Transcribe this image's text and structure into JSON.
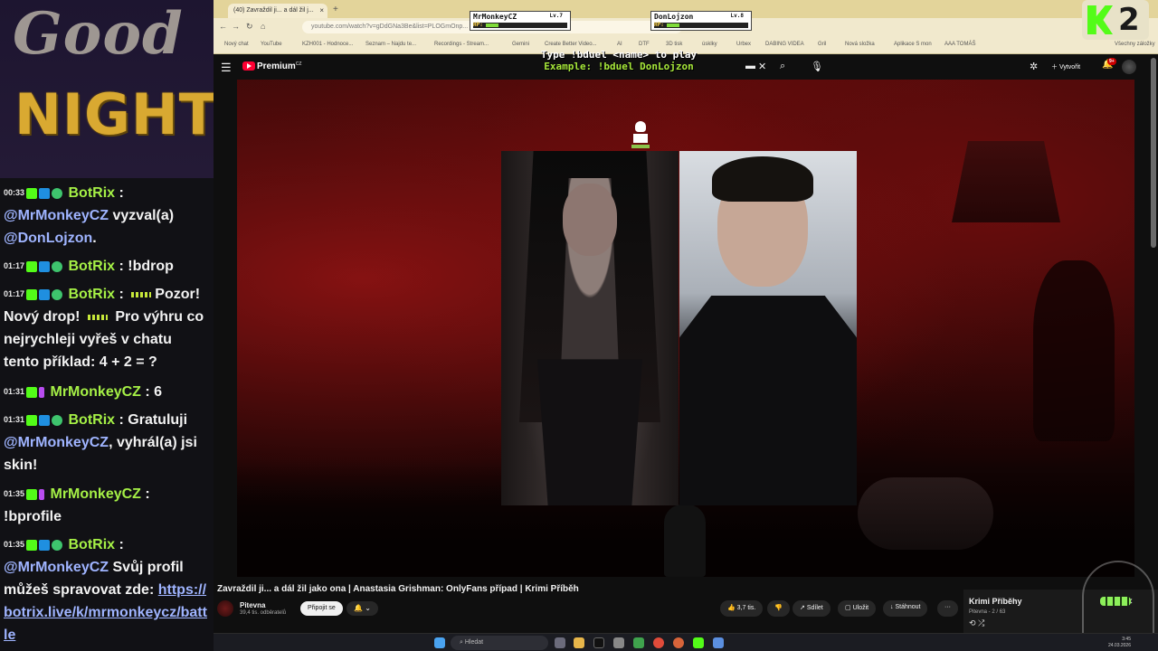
{
  "overlay": {
    "good": "Good",
    "night": "NIGHT",
    "chat": [
      {
        "time": "00:33",
        "nick": "BotRix",
        "badges": [
          "k",
          "b",
          "v"
        ],
        "text_before": "",
        "mention": "@MrMonkeyCZ",
        "text": " vyzval(a) ",
        "mention2": "@DonLojzon",
        "text_after": "."
      },
      {
        "time": "01:17",
        "nick": "BotRix",
        "badges": [
          "k",
          "b",
          "v"
        ],
        "text": "!bdrop"
      },
      {
        "time": "01:17",
        "nick": "BotRix",
        "badges": [
          "k",
          "b",
          "v"
        ],
        "text": "Pozor! Nový drop! ",
        "text2": " Pro výhru co nejrychleji vyřeš v chatu tento příklad: 4 + 2 = ?"
      },
      {
        "time": "01:31",
        "nick": "MrMonkeyCZ",
        "badges": [
          "k",
          "m"
        ],
        "text": "6"
      },
      {
        "time": "01:31",
        "nick": "BotRix",
        "badges": [
          "k",
          "b",
          "v"
        ],
        "text": "Gratuluji ",
        "mention": "@MrMonkeyCZ",
        "text_after": ", vyhrál(a) jsi skin!"
      },
      {
        "time": "01:35",
        "nick": "MrMonkeyCZ",
        "badges": [
          "k",
          "m"
        ],
        "text": "!bprofile"
      },
      {
        "time": "01:35",
        "nick": "BotRix",
        "badges": [
          "k",
          "b",
          "v"
        ],
        "mention": "@MrMonkeyCZ",
        "text_after": " Svůj profil můžeš spravovat zde: ",
        "link": "https://botrix.live/k/mrmonkeycz/battle"
      }
    ]
  },
  "browser": {
    "tab_title": "(40) Zavraždil ji... a dál žil j...",
    "url": "youtube.com/watch?v=gDdGNa3Be&list=PLOGmOnp...",
    "bookmarks": [
      "Nový chat",
      "YouTube",
      "KZH001 - Hodnoce...",
      "Seznam – Najdu te...",
      "Recordings - Stream...",
      "Gemini",
      "Create Better Video...",
      "AI",
      "DTF",
      "3D tisk",
      "úsklky",
      "Urbex",
      "DABING VIDEA",
      "Gril",
      "Nová složka",
      "Aplikace S mon",
      "AAA TOMÁŠ",
      "Všechny záložky"
    ]
  },
  "duel": {
    "p1": {
      "name": "MrMonkeyCZ",
      "level": "Lv.7",
      "hp_label": "HP:"
    },
    "p2": {
      "name": "DonLojzon",
      "level": "Lv.8",
      "hp_label": "HP:"
    },
    "hint_line1": "Type !bduel <name> to play",
    "hint_line2": "Example: !bduel DonLojzon"
  },
  "kick_badge": {
    "number": "2"
  },
  "youtube": {
    "logo": "Premium",
    "logo_country": "CZ",
    "create_label": "Vytvořit",
    "notif_count": "9+",
    "video_title": "Zavraždil ji... a dál žil jako ona | Anastasia Grishman: OnlyFans případ | Krimi Příběh",
    "channel_name": "Pitevna",
    "channel_subs": "39,4 tis. odběratelů",
    "join_label": "Připojit se",
    "likes": "3,7 tis.",
    "share_label": "Sdílet",
    "save_label": "Uložit",
    "download_label": "Stáhnout",
    "more_label": "···",
    "playlist_title": "Krimi Příběhy",
    "playlist_channel": "Pitevna",
    "playlist_pos": "2 / 63"
  },
  "taskbar": {
    "search_placeholder": "Hledat",
    "time": "3:45",
    "date": "24.03.2026"
  }
}
